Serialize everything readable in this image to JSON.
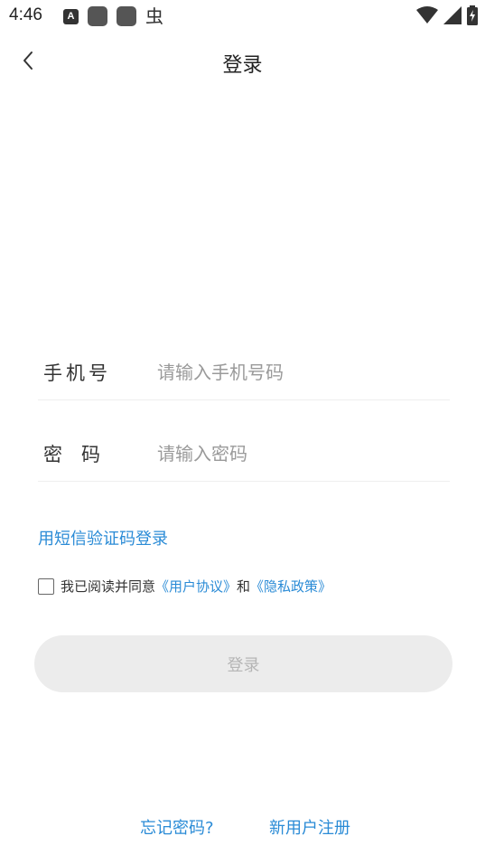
{
  "status_bar": {
    "time": "4:46",
    "notification_a_label": "A",
    "bug_glyph": "虫",
    "icons": [
      "a-notification-icon",
      "app-square-icon",
      "app-square-icon",
      "bug-icon",
      "wifi-icon",
      "signal-icon",
      "battery-charging-icon"
    ]
  },
  "header": {
    "title": "登录",
    "back_icon": "chevron-left-icon"
  },
  "form": {
    "phone": {
      "label": "手机号",
      "placeholder": "请输入手机号码",
      "value": ""
    },
    "password": {
      "label": "密　码",
      "placeholder": "请输入密码",
      "value": ""
    }
  },
  "sms_login_link": "用短信验证码登录",
  "agreement": {
    "checked": false,
    "prefix": "我已阅读并同意",
    "user_agreement": "《用户协议》",
    "conjunction": "和",
    "privacy_policy": "《隐私政策》"
  },
  "login_button": "登录",
  "bottom": {
    "forgot_password": "忘记密码?",
    "register": "新用户注册"
  },
  "colors": {
    "link": "#2a8bd6",
    "button_bg": "#ececec",
    "button_text": "#b5b5b5",
    "placeholder": "#9a9a9a"
  }
}
